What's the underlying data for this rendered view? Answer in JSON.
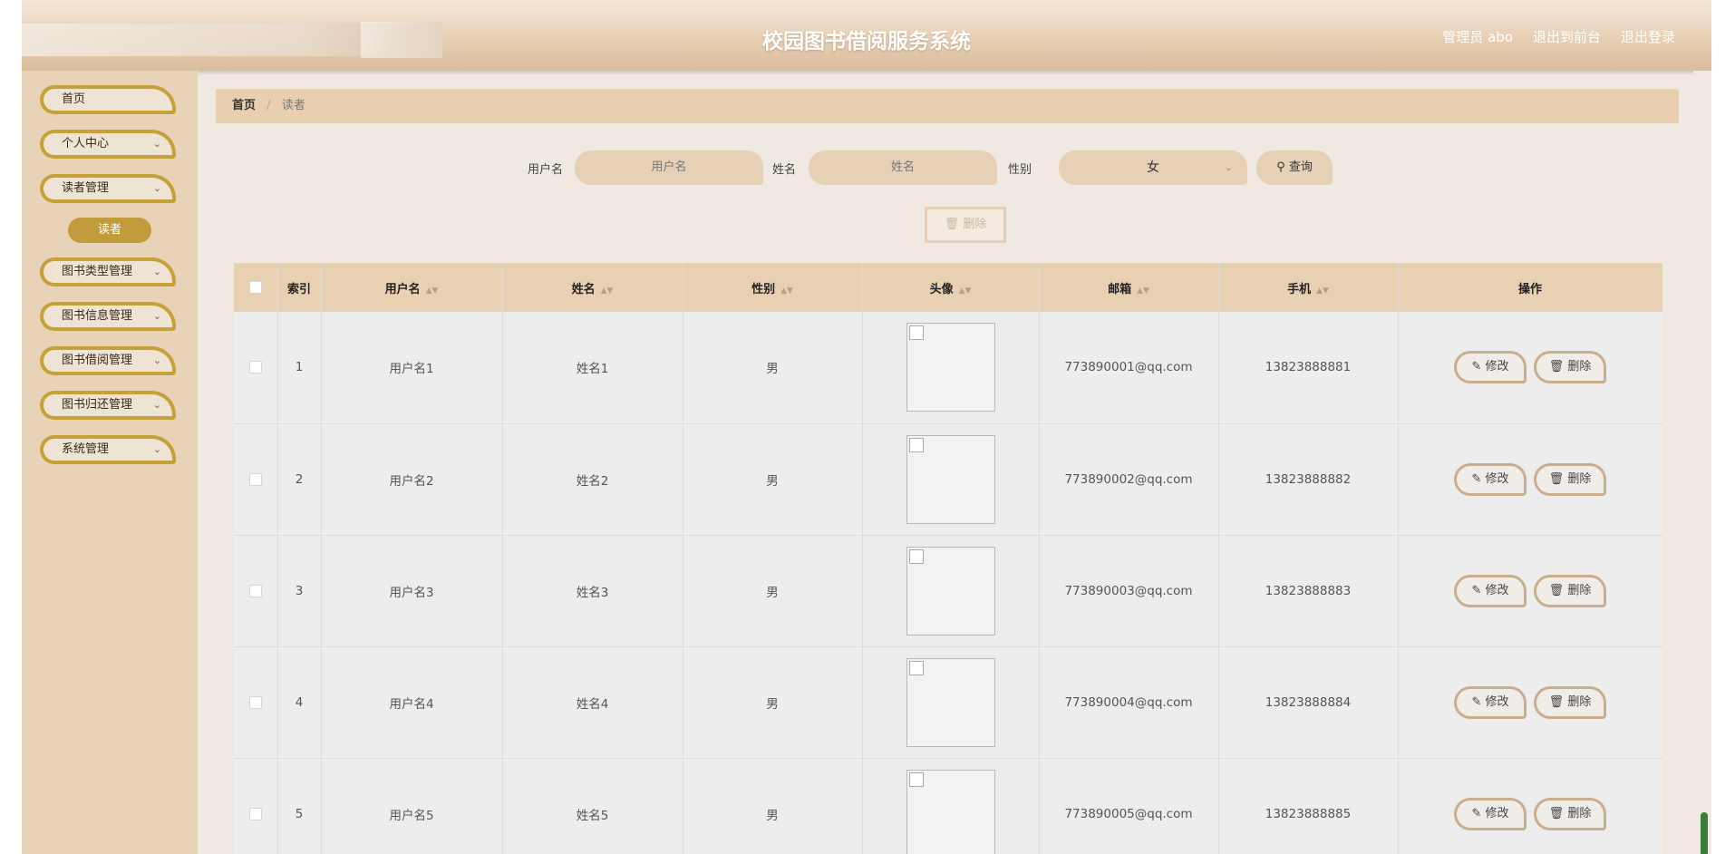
{
  "header": {
    "title": "校园图书借阅服务系统",
    "links": [
      "管理员 abo",
      "退出到前台",
      "退出登录"
    ]
  },
  "sidebar": {
    "items": [
      {
        "label": "首页",
        "has_arrow": false
      },
      {
        "label": "个人中心",
        "has_arrow": true
      },
      {
        "label": "读者管理",
        "has_arrow": true
      },
      {
        "label": "图书类型管理",
        "has_arrow": true
      },
      {
        "label": "图书信息管理",
        "has_arrow": true
      },
      {
        "label": "图书借阅管理",
        "has_arrow": true
      },
      {
        "label": "图书归还管理",
        "has_arrow": true
      },
      {
        "label": "系统管理",
        "has_arrow": true
      }
    ],
    "active_sub": "读者"
  },
  "breadcrumb": {
    "home": "首页",
    "current": "读者"
  },
  "search": {
    "username_label": "用户名",
    "username_placeholder": "用户名",
    "name_label": "姓名",
    "name_placeholder": "姓名",
    "gender_label": "性别",
    "gender_value": "女",
    "search_button": "查询",
    "delete_button": "删除"
  },
  "table": {
    "headers": [
      "索引",
      "用户名",
      "姓名",
      "性别",
      "头像",
      "邮箱",
      "手机",
      "操作"
    ],
    "rows": [
      {
        "index": "1",
        "username": "用户名1",
        "name": "姓名1",
        "gender": "男",
        "email": "773890001@qq.com",
        "phone": "13823888881"
      },
      {
        "index": "2",
        "username": "用户名2",
        "name": "姓名2",
        "gender": "男",
        "email": "773890002@qq.com",
        "phone": "13823888882"
      },
      {
        "index": "3",
        "username": "用户名3",
        "name": "姓名3",
        "gender": "男",
        "email": "773890003@qq.com",
        "phone": "13823888883"
      },
      {
        "index": "4",
        "username": "用户名4",
        "name": "姓名4",
        "gender": "男",
        "email": "773890004@qq.com",
        "phone": "13823888884"
      },
      {
        "index": "5",
        "username": "用户名5",
        "name": "姓名5",
        "gender": "男",
        "email": "773890005@qq.com",
        "phone": "13823888885"
      }
    ],
    "edit_label": "修改",
    "delete_label": "删除"
  },
  "icons": {
    "search": "search-icon",
    "edit": "edit-icon",
    "delete": "trash-icon",
    "chevron": "chevron-down-icon"
  },
  "colors": {
    "accent": "#c29c3c",
    "header_bg": "#e7cfb4",
    "sidebar_bg": "#e8d3b9"
  }
}
